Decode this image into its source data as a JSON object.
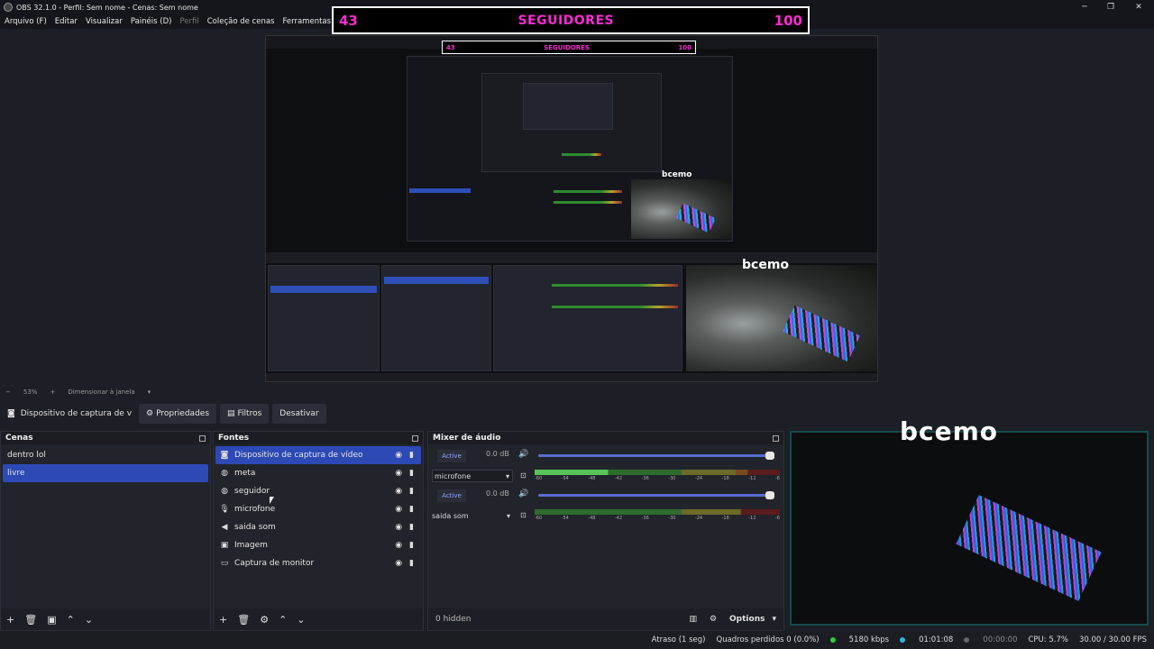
{
  "window": {
    "title": "OBS 32.1.0 - Perfil: Sem nome - Cenas: Sem nome",
    "minimize": "─",
    "restore": "❐",
    "close": "✕"
  },
  "menu": [
    "Arquivo (F)",
    "Editar",
    "Visualizar",
    "Painéis (D)",
    "Perfil",
    "Coleção de cenas",
    "Ferramentas (T)"
  ],
  "overlay": {
    "left_number": "43",
    "label": "SEGUIDORES",
    "right_number": "100"
  },
  "nested_preview": {
    "overlay": {
      "left_number": "43",
      "label": "SEGUIDORES",
      "right_number": "100"
    },
    "caption": "bcemo"
  },
  "zoom": {
    "minus": "−",
    "value": "53%",
    "plus": "+",
    "mode": "Dimensionar à janela"
  },
  "source_toolbar": {
    "selected_source": "Dispositivo de captura de v",
    "properties": "Propriedades",
    "filters": "Filtros",
    "deactivate": "Desativar"
  },
  "scenes": {
    "title": "Cenas",
    "items": [
      {
        "label": "dentro lol",
        "selected": false
      },
      {
        "label": "livre",
        "selected": true
      }
    ]
  },
  "sources": {
    "title": "Fontes",
    "items": [
      {
        "label": "Dispositivo de captura de vídeo",
        "icon": "camera-icon",
        "selected": true
      },
      {
        "label": "meta",
        "icon": "globe-icon",
        "selected": false
      },
      {
        "label": "seguidor",
        "icon": "globe-icon",
        "selected": false
      },
      {
        "label": "microfone",
        "icon": "microphone-icon",
        "selected": false
      },
      {
        "label": "saida som",
        "icon": "speaker-icon",
        "selected": false
      },
      {
        "label": "Imagem",
        "icon": "image-icon",
        "selected": false
      },
      {
        "label": "Captura de monitor",
        "icon": "monitor-icon",
        "selected": false
      }
    ]
  },
  "mixer": {
    "title": "Mixer de áudio",
    "tracks": [
      {
        "name": "microfone",
        "status": "Active",
        "db": "0.0 dB",
        "volume": 1.0
      },
      {
        "name": "saida som",
        "status": "Active",
        "db": "0.0 dB",
        "volume": 1.0
      }
    ],
    "scale": [
      "-60",
      "-54",
      "-48",
      "-42",
      "-36",
      "-30",
      "-24",
      "-18",
      "-12",
      "-6"
    ],
    "hidden": "0 hidden",
    "options": "Options"
  },
  "caption_large": "bcemo",
  "status": {
    "delay": "Atraso (1 seg)",
    "dropped": "Quadros perdidos 0 (0.0%)",
    "bitrate": "5180 kbps",
    "stream_time": "01:01:08",
    "rec_time": "00:00:00",
    "cpu": "CPU: 5.7%",
    "fps": "30.00 / 30.00 FPS"
  },
  "colors": {
    "accent": "#2d49b6",
    "overlay_text": "#ff2bd6",
    "meter_green": "#2e8b2e"
  }
}
